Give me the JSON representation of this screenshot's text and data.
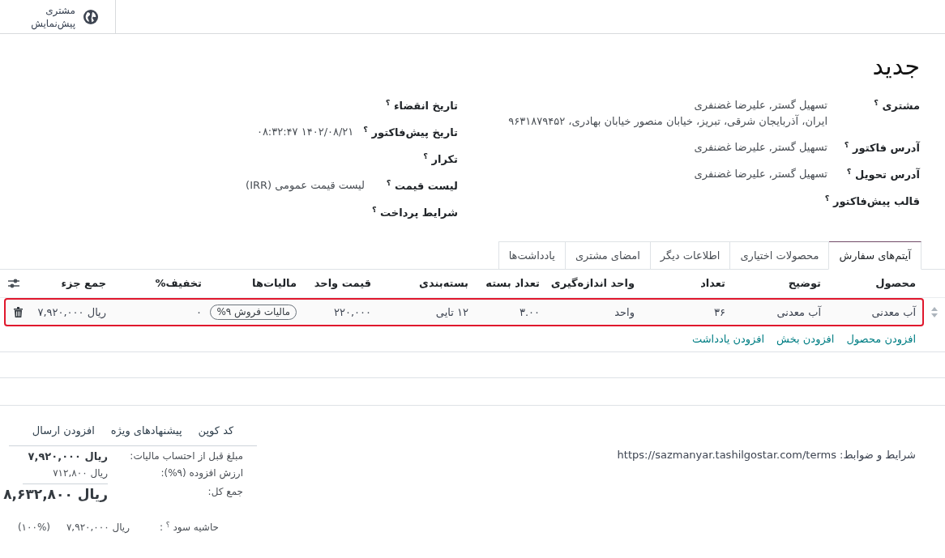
{
  "control_panel": {
    "preview_button": "مشتری پیش‌نمایش"
  },
  "title": "جدید",
  "form_groups": [
    {
      "fields": [
        {
          "label": "مشتری $^{؟}$",
          "lines": [
            "تسهیل گستر, علیرضا غضنفری",
            "ایران، آذربایجان شرقی، تبریز، خیابان منصور خیابان بهادری، ۹۶۳۱۸۷۹۴۵۲"
          ]
        },
        {
          "label": "آدرس فاکتور $^{؟}$",
          "lines": [
            "تسهیل گستر, علیرضا غضنفری"
          ]
        },
        {
          "label": "آدرس تحویل $^{؟}$",
          "lines": [
            "تسهیل گستر, علیرضا غضنفری"
          ]
        },
        {
          "label": "قالب پیش‌فاکتور $^{؟}$"
        }
      ]
    },
    {
      "fields": [
        {
          "label": "تاریخ انقضاء $^{؟}$"
        },
        {
          "label": "تاریخ پیش‌فاکتور $^{؟}$",
          "lines": [
            "۱۴۰۲/۰۸/۲۱ ۰۸:۳۲:۴۷"
          ]
        },
        {
          "label": "تکرار $^{؟}$"
        },
        {
          "label": "لیست قیمت $^{؟}$",
          "lines": [
            "لیست قیمت عمومی (IRR)"
          ]
        },
        {
          "label": "شرایط پرداخت $^{؟}$"
        }
      ]
    }
  ],
  "tabs": [
    {
      "label": "آیتم‌های سفارش",
      "selected": true
    },
    {
      "label": "محصولات اختیاری",
      "selected": false
    },
    {
      "label": "اطلاعات دیگر",
      "selected": false
    },
    {
      "label": "امضای مشتری",
      "selected": false
    },
    {
      "label": "یادداشت‌ها",
      "selected": false
    }
  ],
  "table": {
    "columns": [
      "محصول",
      "توضیح",
      "تعداد",
      "واحد اندازه‌گیری",
      "تعداد بسته",
      "بسته‌بندی",
      "قیمت واحد",
      "مالیات‌ها",
      "تخفیف%",
      "جمع جزء"
    ],
    "rows": [
      {
        "highlighted": true,
        "cells": [
          {
            "kind": "text",
            "text": "آب معدنی"
          },
          {
            "kind": "text",
            "text": "آب معدنی"
          },
          {
            "kind": "text",
            "text": "۳۶"
          },
          {
            "kind": "text",
            "text": "واحد"
          },
          {
            "kind": "text",
            "text": "۳.۰۰"
          },
          {
            "kind": "text",
            "text": "۱۲ تایی"
          },
          {
            "kind": "text",
            "text": "۲۲۰,۰۰۰"
          },
          {
            "kind": "tag",
            "text": "مالیات فروش ۹%"
          },
          {
            "kind": "text",
            "text": "۰"
          },
          {
            "kind": "text",
            "text": "ریال ۷,۹۲۰,۰۰۰"
          }
        ]
      }
    ],
    "add_links": [
      "افزودن محصول",
      "افزودن بخش",
      "افزودن یادداشت"
    ]
  },
  "terms": "شرایط و ضوابط: https://sazmanyar.tashilgostar.com/terms",
  "summary": {
    "actions": [
      "کد کوپن",
      "پیشنهادهای ویژه",
      "افزودن ارسال"
    ],
    "totals": [
      {
        "kind": "subtotal",
        "label": "مبلغ قبل از احتساب مالیات:",
        "value": "ریال ۷,۹۲۰,۰۰۰"
      },
      {
        "kind": "tax",
        "label": "ارزش افزوده (۹%):",
        "value": "ریال ۷۱۲,۸۰۰"
      },
      {
        "kind": "total",
        "label": "جمع کل:",
        "value": "ریال ۸,۶۳۲,۸۰۰"
      }
    ],
    "margin": {
      "label": "حاشیه سود $^{؟}$ :",
      "value": "ریال ۷,۹۲۰,۰۰۰",
      "percent": "(۱۰۰%)"
    }
  }
}
